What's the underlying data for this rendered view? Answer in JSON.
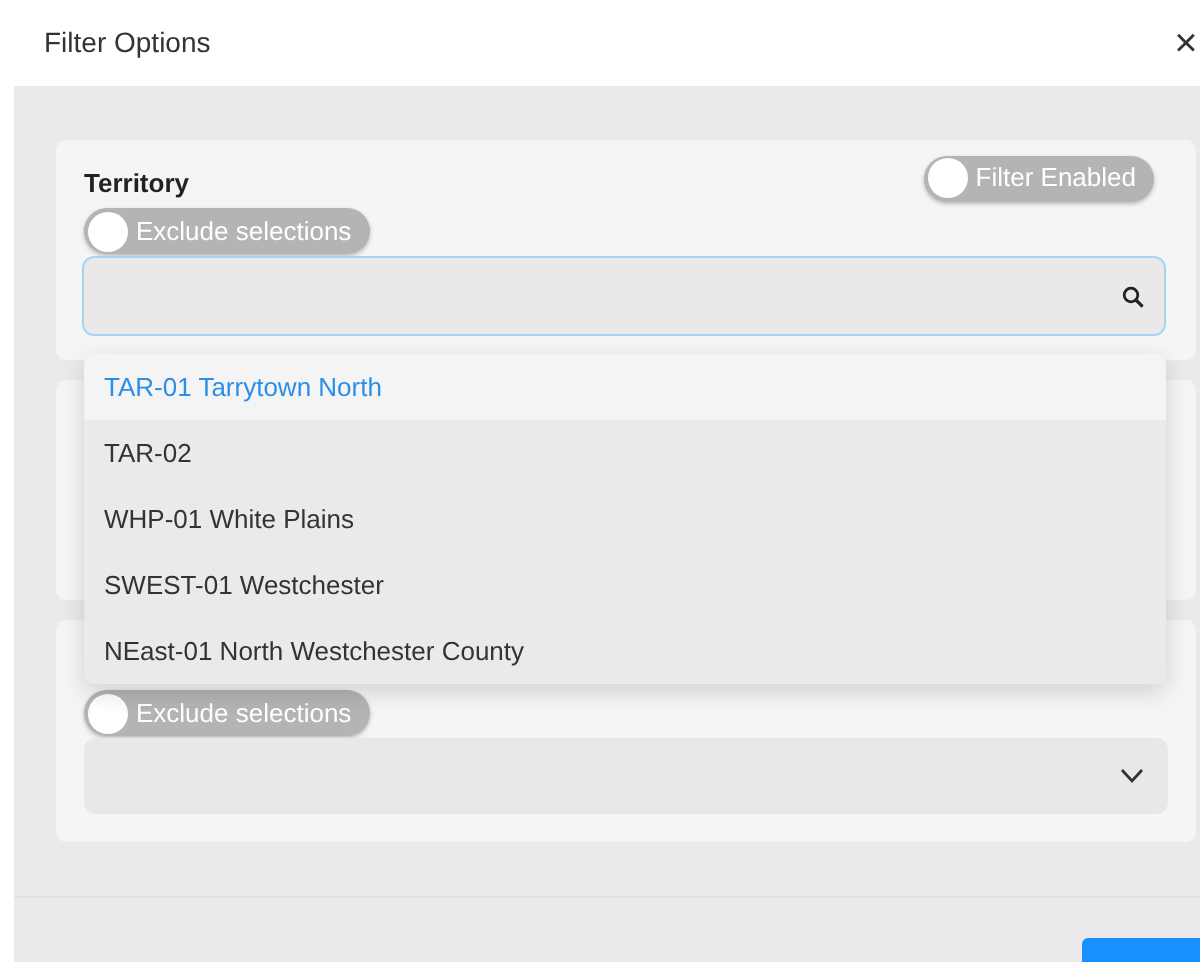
{
  "dialog": {
    "title": "Filter Options",
    "close": "×"
  },
  "territory": {
    "label": "Territory",
    "filter_toggle": {
      "label": "Filter Enabled",
      "on": false
    },
    "exclude_toggle": {
      "label": "Exclude selections",
      "on": false
    },
    "options": [
      {
        "label": "TAR-01 Tarrytown North",
        "selected": true
      },
      {
        "label": "TAR-02",
        "selected": false
      },
      {
        "label": "WHP-01 White Plains",
        "selected": false
      },
      {
        "label": "SWEST-01 Westchester",
        "selected": false
      },
      {
        "label": "NEast-01 North Westchester County",
        "selected": false
      }
    ]
  },
  "third_filter": {
    "exclude_toggle": {
      "label": "Exclude selections",
      "on": false
    }
  }
}
